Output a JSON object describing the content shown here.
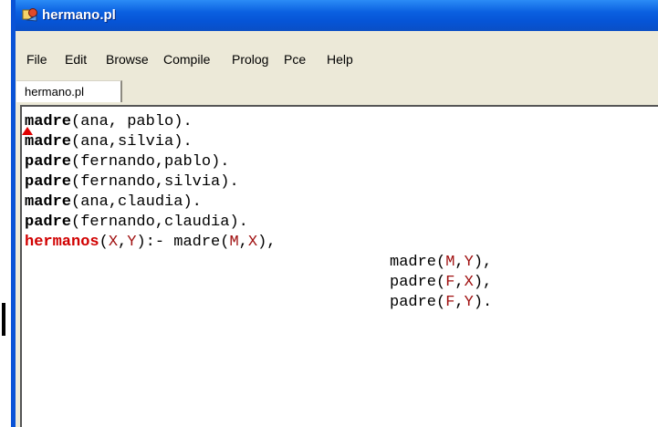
{
  "window": {
    "title": "hermano.pl"
  },
  "menu": {
    "items": [
      "File",
      "Edit",
      "Browse",
      "Compile",
      "Prolog",
      "Pce",
      "Help"
    ]
  },
  "tab": {
    "label": "hermano.pl"
  },
  "colors": {
    "titlebar": "#0654d6",
    "keyword_head": "#d10000",
    "variable": "#a01010",
    "caret": "#e00000"
  },
  "icons": {
    "app": "xpce-app-icon"
  },
  "code": {
    "lines": [
      {
        "pred": "madre",
        "open": "(",
        "args": [
          {
            "t": "ana"
          },
          {
            "t": ", "
          },
          {
            "t": "pablo"
          }
        ],
        "close": ")."
      },
      {
        "pred": "madre",
        "open": "(",
        "args": [
          {
            "t": "ana"
          },
          {
            "t": ","
          },
          {
            "t": "silvia"
          }
        ],
        "close": ")."
      },
      {
        "pred": "padre",
        "open": "(",
        "args": [
          {
            "t": "fernando"
          },
          {
            "t": ","
          },
          {
            "t": "pablo"
          }
        ],
        "close": ")."
      },
      {
        "pred": "padre",
        "open": "(",
        "args": [
          {
            "t": "fernando"
          },
          {
            "t": ","
          },
          {
            "t": "silvia"
          }
        ],
        "close": ")."
      },
      {
        "pred": "madre",
        "open": "(",
        "args": [
          {
            "t": "ana"
          },
          {
            "t": ","
          },
          {
            "t": "claudia"
          }
        ],
        "close": ")."
      },
      {
        "pred": "padre",
        "open": "(",
        "args": [
          {
            "t": "fernando"
          },
          {
            "t": ","
          },
          {
            "t": "claudia"
          }
        ],
        "close": ")."
      },
      {
        "head": "hermanos",
        "open": "(",
        "args": [
          {
            "t": "X",
            "v": true
          },
          {
            "t": ","
          },
          {
            "t": "Y",
            "v": true
          }
        ],
        "close": "):- madre(",
        "args2": [
          {
            "t": "M",
            "v": true
          },
          {
            "t": ","
          },
          {
            "t": "X",
            "v": true
          }
        ],
        "close2": "),"
      },
      {
        "indent": true,
        "call": "madre",
        "open": "(",
        "args": [
          {
            "t": "M",
            "v": true
          },
          {
            "t": ","
          },
          {
            "t": "Y",
            "v": true
          }
        ],
        "close": "),"
      },
      {
        "indent": true,
        "call": "padre",
        "open": "(",
        "args": [
          {
            "t": "F",
            "v": true
          },
          {
            "t": ","
          },
          {
            "t": "X",
            "v": true
          }
        ],
        "close": "),"
      },
      {
        "indent": true,
        "call": "padre",
        "open": "(",
        "args": [
          {
            "t": "F",
            "v": true
          },
          {
            "t": ","
          },
          {
            "t": "Y",
            "v": true
          }
        ],
        "close": ")."
      }
    ]
  }
}
